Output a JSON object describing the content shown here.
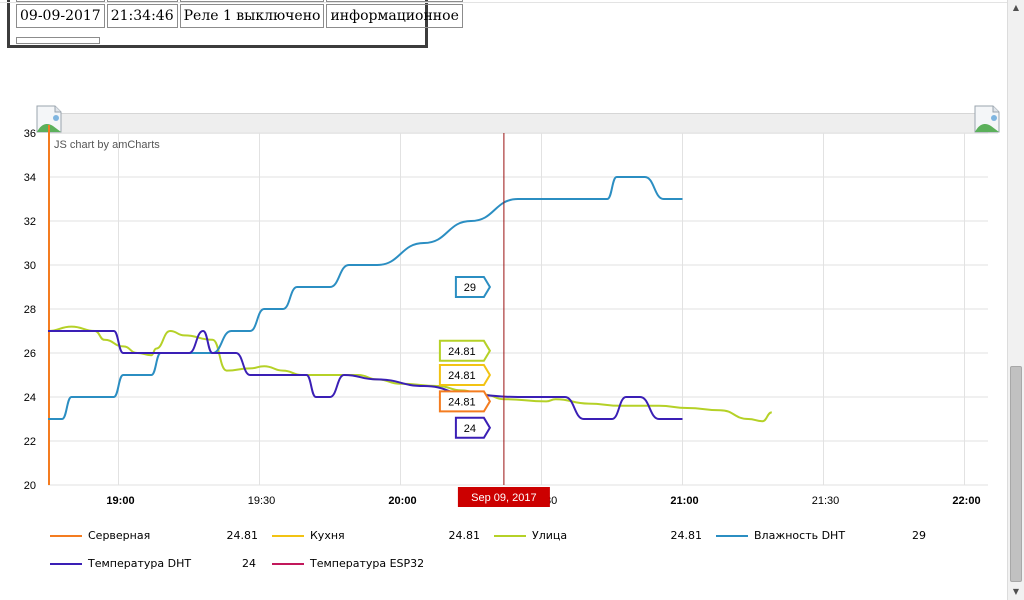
{
  "log_table": {
    "rows": [
      {
        "date": "09-09-2017",
        "time": "21:34:46",
        "event": "Реле 1 выключено",
        "level": "информационное"
      }
    ]
  },
  "chart_data": {
    "type": "line",
    "credit": "JS chart by amCharts",
    "ylim": [
      20,
      36
    ],
    "y_ticks": [
      "20",
      "22",
      "24",
      "26",
      "28",
      "30",
      "32",
      "34",
      "36"
    ],
    "x_range_minutes": [
      0,
      1000
    ],
    "x_ticks": [
      {
        "label": "19:00",
        "bold": true,
        "m": 75
      },
      {
        "label": "19:30",
        "bold": false,
        "m": 105
      },
      {
        "label": "20:00",
        "bold": true,
        "m": 135
      },
      {
        "label": "20:30",
        "bold": false,
        "m": 165
      },
      {
        "label": "21:00",
        "bold": true,
        "m": 195
      },
      {
        "label": "21:30",
        "bold": false,
        "m": 225
      },
      {
        "label": "22:00",
        "bold": true,
        "m": 255
      }
    ],
    "cursor": {
      "label": "Sep 09, 2017",
      "m": 157,
      "color": "#cc0000"
    },
    "grid": true,
    "series": [
      {
        "name": "Серверная",
        "color": "#f47c20",
        "legend_value": "24.81",
        "balloon": "24.81",
        "points": []
      },
      {
        "name": "Кухня",
        "color": "#f2c313",
        "legend_value": "24.81",
        "balloon": "24.81",
        "points": []
      },
      {
        "name": "Улица",
        "color": "#b5d127",
        "legend_value": "24.81",
        "balloon": "24.81",
        "points": [
          [
            60,
            27
          ],
          [
            65,
            27.2
          ],
          [
            70,
            27
          ],
          [
            72,
            26.6
          ],
          [
            76,
            26.3
          ],
          [
            79,
            26
          ],
          [
            82,
            25.9
          ],
          [
            83,
            26.2
          ],
          [
            86,
            27
          ],
          [
            89,
            26.8
          ],
          [
            95,
            26.6
          ],
          [
            98,
            25.2
          ],
          [
            103,
            25.3
          ],
          [
            106,
            25.4
          ],
          [
            110,
            25.2
          ],
          [
            114,
            25
          ],
          [
            120,
            25
          ],
          [
            126,
            25
          ],
          [
            130,
            24.8
          ],
          [
            135,
            24.6
          ],
          [
            143,
            24.5
          ],
          [
            148,
            24.3
          ],
          [
            153,
            24.1
          ],
          [
            157,
            23.9
          ],
          [
            166,
            23.8
          ],
          [
            168,
            23.9
          ],
          [
            175,
            23.7
          ],
          [
            182,
            23.6
          ],
          [
            190,
            23.6
          ],
          [
            196,
            23.5
          ],
          [
            203,
            23.4
          ],
          [
            209,
            23.0
          ],
          [
            212,
            22.9
          ],
          [
            214,
            23.3
          ]
        ]
      },
      {
        "name": "Влажность DHT",
        "color": "#2b8ec2",
        "legend_value": "29",
        "balloon": "29",
        "points": [
          [
            60,
            23
          ],
          [
            63,
            23
          ],
          [
            65,
            24
          ],
          [
            70,
            24
          ],
          [
            74,
            24
          ],
          [
            76,
            25
          ],
          [
            80,
            25
          ],
          [
            82,
            25
          ],
          [
            84,
            26
          ],
          [
            88,
            26
          ],
          [
            92,
            26
          ],
          [
            95,
            26
          ],
          [
            99,
            27
          ],
          [
            103,
            27
          ],
          [
            106,
            28
          ],
          [
            110,
            28
          ],
          [
            113,
            29
          ],
          [
            117,
            29
          ],
          [
            120,
            29
          ],
          [
            124,
            30
          ],
          [
            130,
            30
          ],
          [
            140,
            31
          ],
          [
            150,
            32
          ],
          [
            160,
            33
          ],
          [
            175,
            33
          ],
          [
            179,
            33
          ],
          [
            181,
            34
          ],
          [
            187,
            34
          ],
          [
            191,
            33
          ],
          [
            195,
            33
          ]
        ]
      },
      {
        "name": "Температура DHT",
        "color": "#3a1fb5",
        "legend_value": "24",
        "balloon": "24",
        "points": [
          [
            60,
            27
          ],
          [
            70,
            27
          ],
          [
            74,
            27
          ],
          [
            76,
            26
          ],
          [
            83,
            26
          ],
          [
            90,
            26
          ],
          [
            93,
            27
          ],
          [
            95,
            26
          ],
          [
            100,
            26
          ],
          [
            103,
            25
          ],
          [
            108,
            25
          ],
          [
            115,
            25
          ],
          [
            117,
            24
          ],
          [
            120,
            24
          ],
          [
            123,
            25
          ],
          [
            130,
            24.8
          ],
          [
            140,
            24.5
          ],
          [
            150,
            24.1
          ],
          [
            160,
            24
          ],
          [
            170,
            24
          ],
          [
            174,
            23
          ],
          [
            180,
            23
          ],
          [
            183,
            24
          ],
          [
            186,
            24
          ],
          [
            190,
            23
          ],
          [
            195,
            23
          ]
        ]
      },
      {
        "name": "Температура ESP32",
        "color": "#c2185b",
        "legend_value": "",
        "balloon": "",
        "points": []
      }
    ]
  }
}
